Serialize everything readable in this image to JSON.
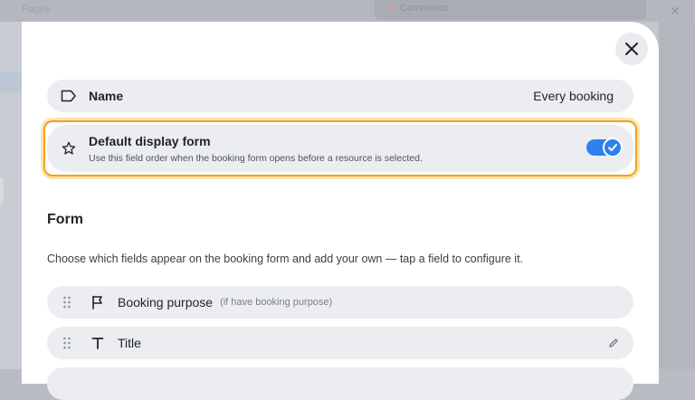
{
  "background": {
    "top_left_text": "Pages",
    "top_pill_text": "Comments",
    "accent_dim": "#c7a3aa"
  },
  "modal": {
    "close_icon": "close-icon",
    "name_row": {
      "icon": "tag-icon",
      "label": "Name",
      "value": "Every booking"
    },
    "default_display": {
      "icon": "star-icon",
      "title": "Default display form",
      "description": "Use this field order when the booking form opens before a resource is selected.",
      "toggle_on": true,
      "highlight_color": "#f0a11e",
      "toggle_color": "#2f80ed"
    },
    "form_section": {
      "title": "Form",
      "description": "Choose which fields appear on the booking form and add your own — tap a field to configure it."
    },
    "fields": [
      {
        "icon": "flag-icon",
        "label": "Booking purpose",
        "hint": "(if have booking purpose)"
      },
      {
        "icon": "text-icon",
        "label": "Title",
        "hint": ""
      }
    ]
  }
}
